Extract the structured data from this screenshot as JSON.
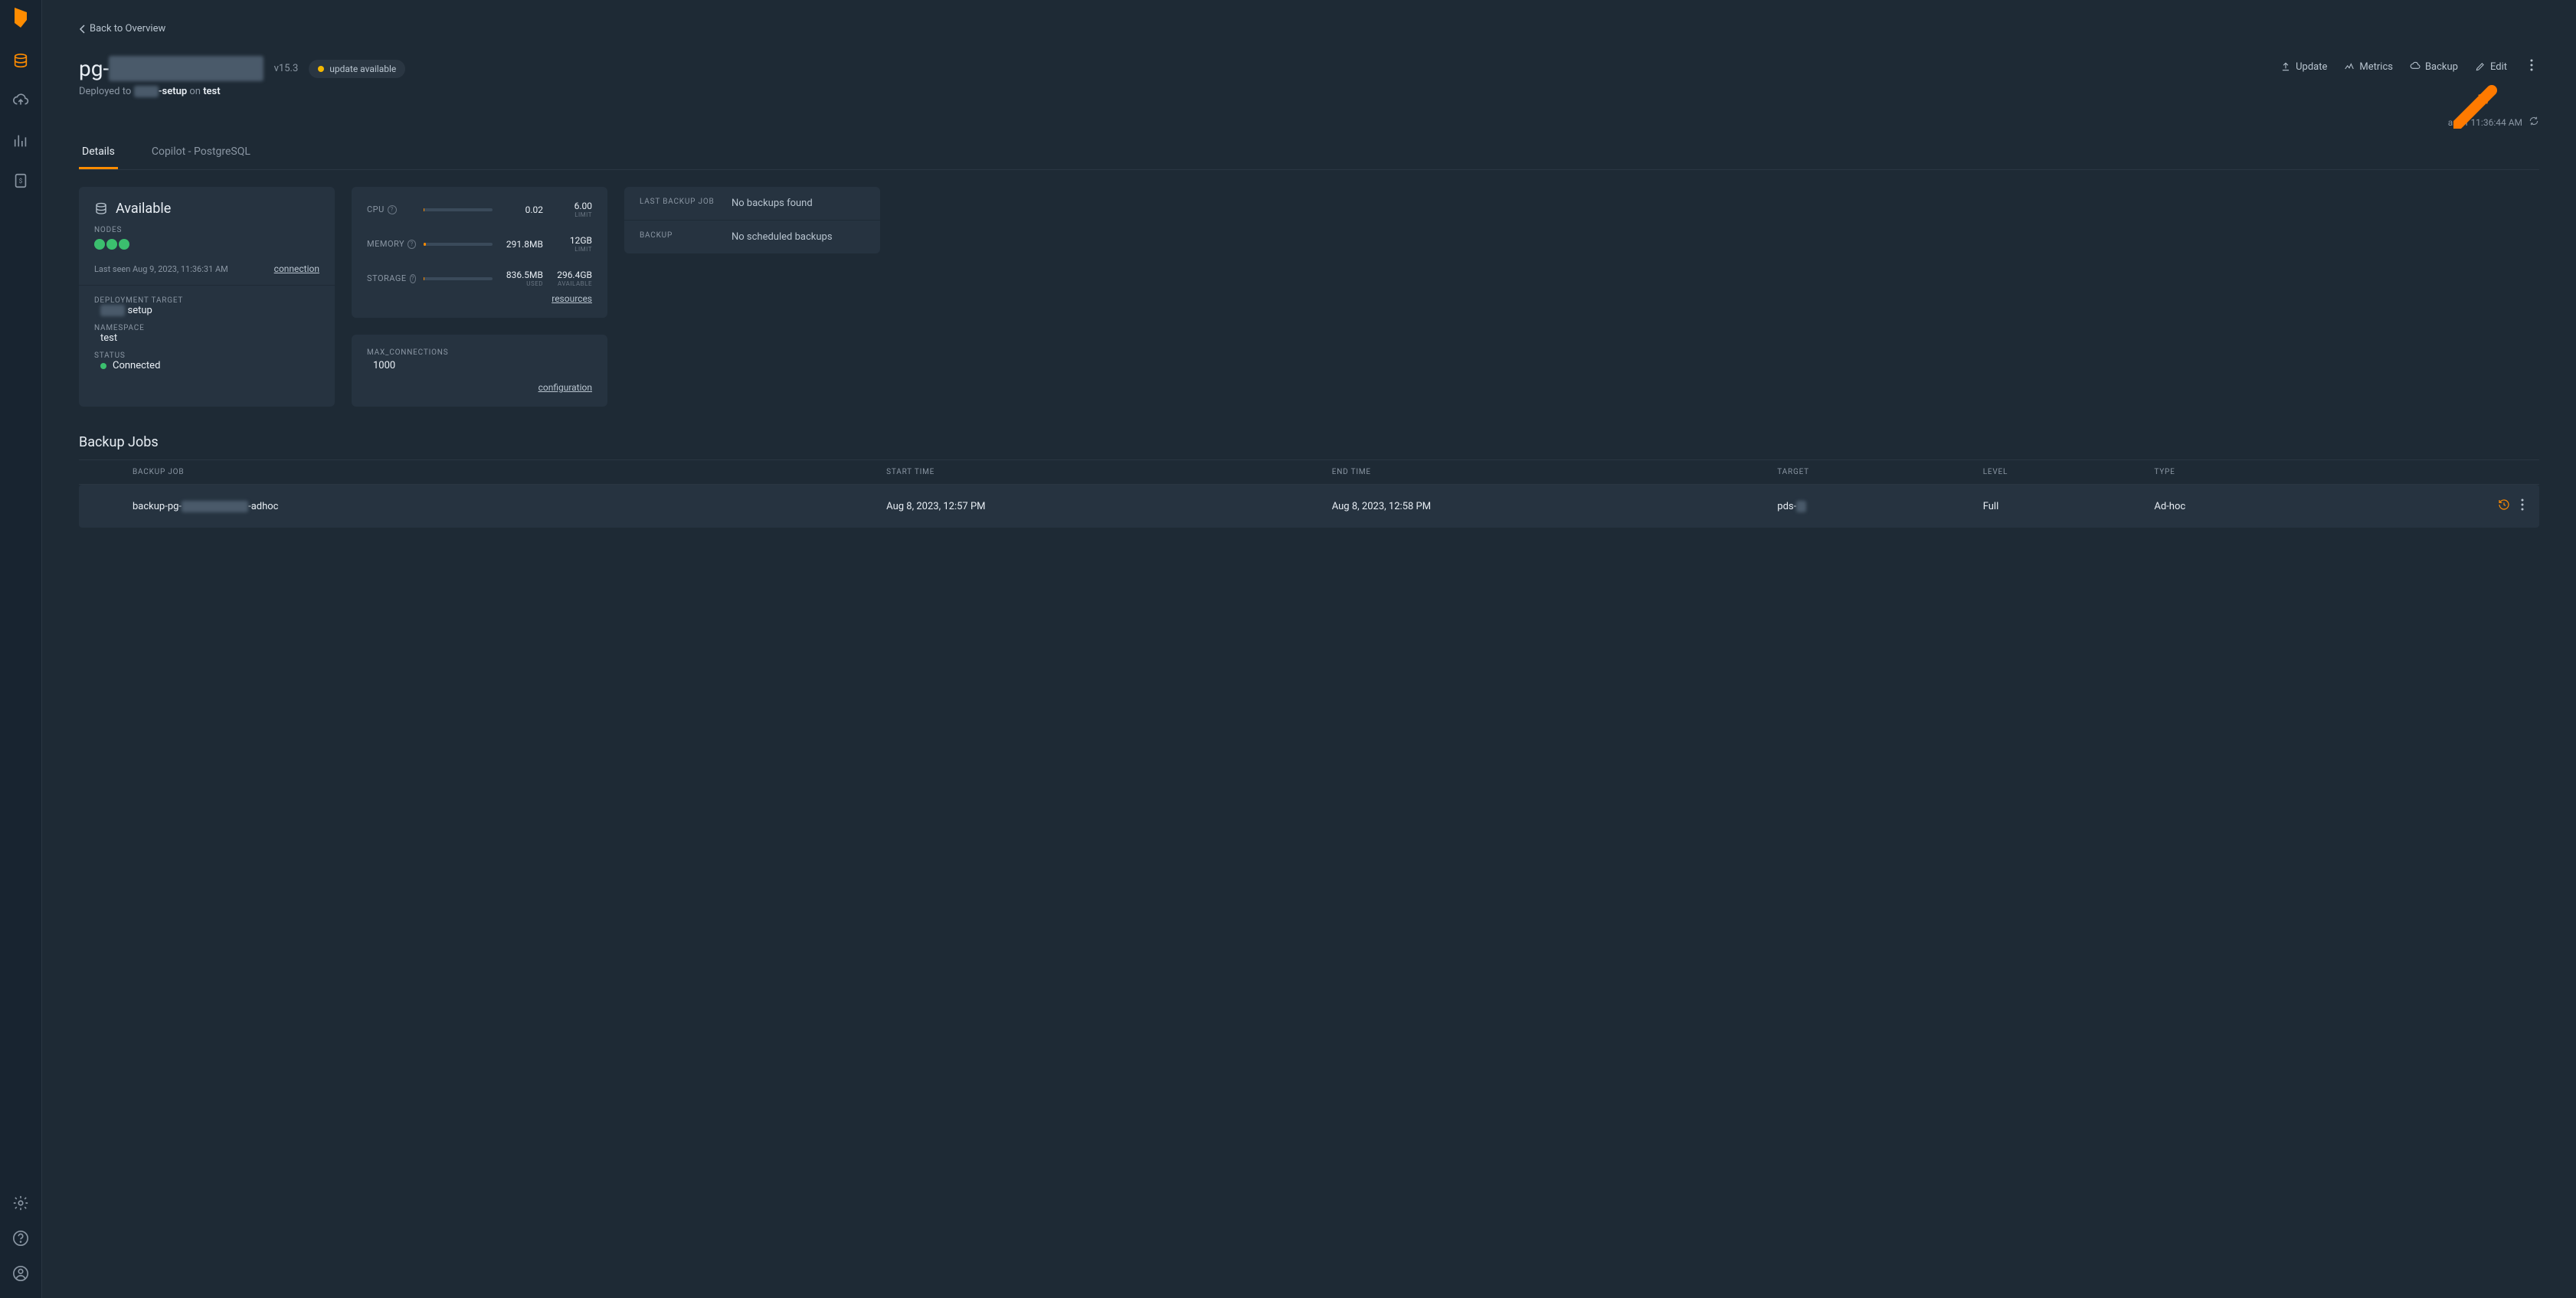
{
  "back_link": "Back to Overview",
  "title_prefix": "pg-",
  "title_redacted": "xxxxxxxx xxxxxx",
  "version": "v15.3",
  "update_badge": "update available",
  "actions": {
    "update": "Update",
    "metrics": "Metrics",
    "backup": "Backup",
    "edit": "Edit"
  },
  "deployed_prefix": "Deployed to ",
  "deployed_mid": "-setup",
  "deployed_on": " on ",
  "deployed_env": "test",
  "refresh_text": "as of 11:36:44 AM",
  "tabs": {
    "details": "Details",
    "copilot": "Copilot - PostgreSQL"
  },
  "status": {
    "heading": "Available",
    "nodes_label": "Nodes",
    "last_seen": "Last seen Aug 9, 2023, 11:36:31 AM",
    "connection_link": "connection",
    "deployment_target_label": "Deployment Target",
    "deployment_target_value": "setup",
    "namespace_label": "Namespace",
    "namespace_value": "test",
    "status_label": "Status",
    "status_value": "Connected"
  },
  "resources": {
    "cpu_label": "CPU",
    "cpu_val": "0.02",
    "cpu_limit": "6.00",
    "cpu_limit_label": "Limit",
    "memory_label": "Memory",
    "memory_val": "291.8MB",
    "memory_limit": "12GB",
    "memory_limit_label": "Limit",
    "storage_label": "Storage",
    "storage_used": "836.5MB",
    "storage_used_label": "Used",
    "storage_avail": "296.4GB",
    "storage_avail_label": "Available",
    "resources_link": "resources"
  },
  "config": {
    "max_conn_label": "Max_Connections",
    "max_conn_value": "1000",
    "config_link": "configuration"
  },
  "backup_card": {
    "last_job_label": "Last Backup Job",
    "last_job_value": "No backups found",
    "backup_label": "Backup",
    "backup_value": "No scheduled backups"
  },
  "backup_jobs": {
    "title": "Backup Jobs",
    "headers": {
      "job": "Backup Job",
      "start": "Start Time",
      "end": "End Time",
      "target": "Target",
      "level": "Level",
      "type": "Type"
    },
    "rows": [
      {
        "job_prefix": "backup-pg-",
        "job_redacted": "xxxxxx xxxxxxx",
        "job_suffix": "-adhoc",
        "start": "Aug 8, 2023, 12:57 PM",
        "end": "Aug 8, 2023, 12:58 PM",
        "target_prefix": "pds-",
        "level": "Full",
        "type": "Ad-hoc"
      }
    ]
  }
}
